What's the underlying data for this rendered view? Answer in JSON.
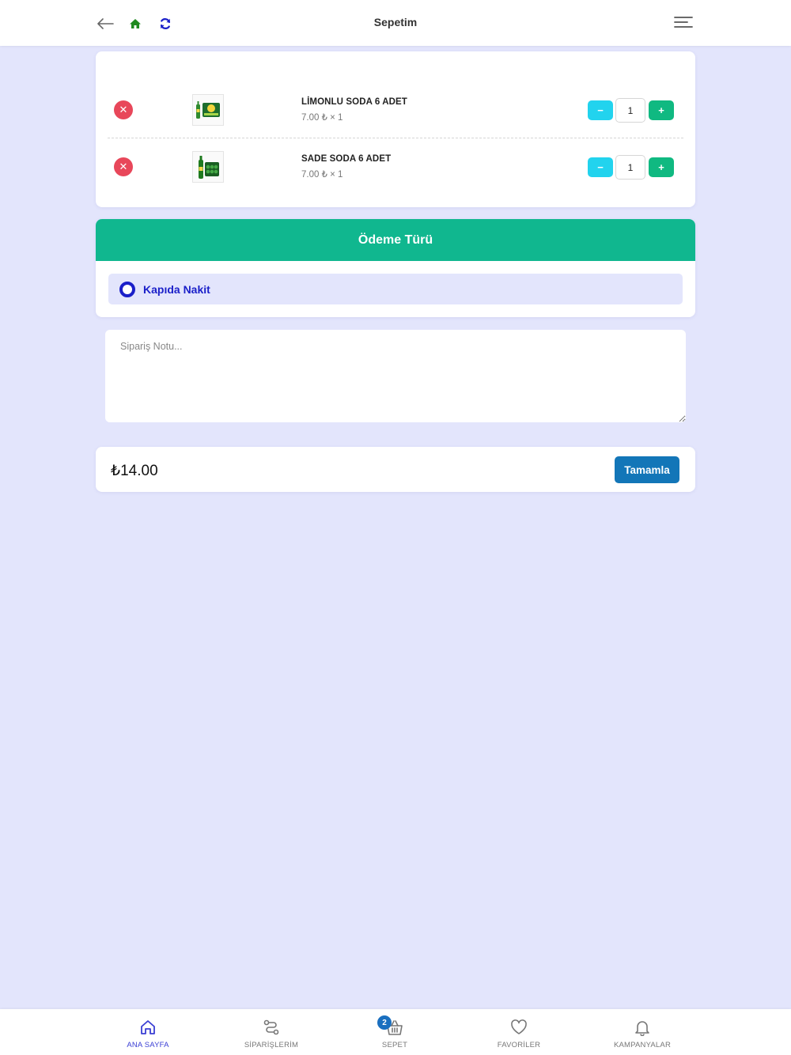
{
  "header": {
    "title": "Sepetim",
    "back_icon": "arrow-left-icon",
    "home_icon": "home-icon",
    "refresh_icon": "refresh-icon",
    "menu_icon": "menu-icon"
  },
  "cart": {
    "items": [
      {
        "name": "LİMONLU SODA 6 ADET",
        "price_line": "7.00 ₺ × 1",
        "quantity": "1"
      },
      {
        "name": "SADE SODA 6 ADET",
        "price_line": "7.00 ₺ × 1",
        "quantity": "1"
      }
    ],
    "minus_label": "−",
    "plus_label": "+"
  },
  "payment": {
    "title": "Ödeme Türü",
    "option_label": "Kapıda Nakit"
  },
  "note": {
    "placeholder": "Sipariş Notu..."
  },
  "total": {
    "amount": "₺14.00",
    "complete_label": "Tamamla"
  },
  "nav": {
    "items": [
      {
        "label": "ANA SAYFA",
        "icon": "home-outline-icon",
        "active": true
      },
      {
        "label": "SİPARİŞLERİM",
        "icon": "route-icon",
        "active": false
      },
      {
        "label": "SEPET",
        "icon": "basket-icon",
        "active": false,
        "badge": "2"
      },
      {
        "label": "FAVORİLER",
        "icon": "heart-icon",
        "active": false
      },
      {
        "label": "KAMPANYALAR",
        "icon": "bell-icon",
        "active": false
      }
    ]
  },
  "colors": {
    "page_bg": "#e3e5fc",
    "accent_green": "#10b78f",
    "accent_blue": "#1376b8",
    "radio_blue": "#1a1fc9",
    "remove_red": "#e8475a",
    "minus_cyan": "#22d3ee",
    "plus_green": "#10b981"
  }
}
